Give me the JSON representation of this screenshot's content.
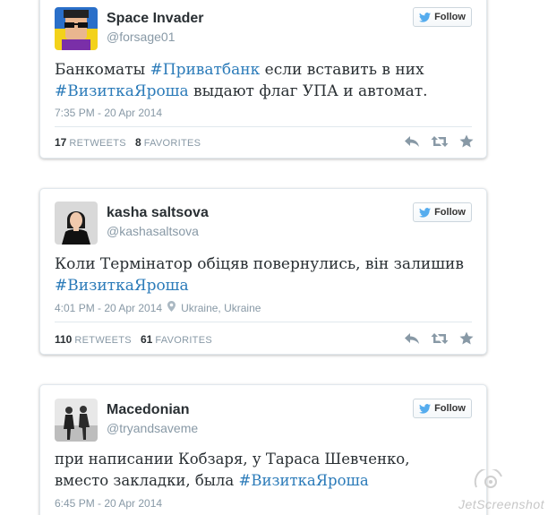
{
  "tweets": [
    {
      "name": "Space Invader",
      "handle": "@forsage01",
      "follow_label": "Follow",
      "text_parts": [
        "Банкоматы ",
        "#Приватбанк",
        " если вставить в них ",
        "#ВизиткаЯроша",
        " выдают флаг УПА и автомат."
      ],
      "time": "7:35 PM - 20 Apr 2014",
      "retweets": "17",
      "retweets_label": "RETWEETS",
      "favorites": "8",
      "favorites_label": "FAVORITES"
    },
    {
      "name": "kasha saltsova",
      "handle": "@kashasaltsova",
      "follow_label": "Follow",
      "text_parts": [
        "Коли Термінатор обіцяв повернулись, він залишив ",
        "#ВизиткаЯроша"
      ],
      "time": "4:01 PM - 20 Apr 2014",
      "location": "Ukraine, Ukraine",
      "retweets": "110",
      "retweets_label": "RETWEETS",
      "favorites": "61",
      "favorites_label": "FAVORITES"
    },
    {
      "name": "Macedonian",
      "handle": "@tryandsaveme",
      "follow_label": "Follow",
      "text_parts": [
        "при написании Кобзаря, у Тараса Шевченко, вместо закладки, была ",
        "#ВизиткаЯроша"
      ],
      "time": "6:45 PM - 20 Apr 2014"
    }
  ],
  "watermark": "JetScreenshot",
  "colors": {
    "hashtag": "#2b7bb9",
    "twitter_blue": "#55acee",
    "muted": "#8899a6"
  },
  "icons": [
    "twitter-bird-icon",
    "reply-icon",
    "retweet-icon",
    "favorite-star-icon",
    "location-pin-icon"
  ]
}
